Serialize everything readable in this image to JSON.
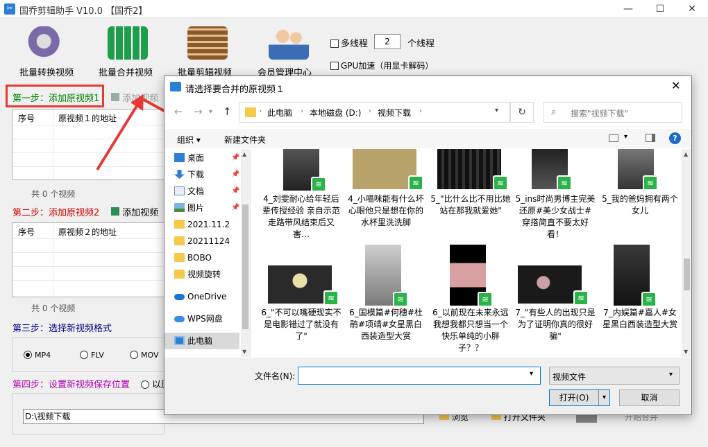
{
  "window": {
    "title": "国乔剪辑助手 V10.0   【国乔2】",
    "icon_text": "✂",
    "min": "—",
    "max": "☐",
    "close": "✕"
  },
  "toolbar": [
    {
      "label": "批量转换视频",
      "icon": "film-reel-convert-icon"
    },
    {
      "label": "批量合并视频",
      "icon": "merge-grid-icon"
    },
    {
      "label": "批量剪辑视频",
      "icon": "film-cut-icon"
    },
    {
      "label": "会员管理中心",
      "icon": "members-icon"
    }
  ],
  "options": {
    "multithread_label": "多线程",
    "thread_count": "2",
    "thread_unit": "个线程",
    "gpu_label": "GPU加速（用显卡解码）"
  },
  "step1": {
    "label": "第一步：添加原视频1",
    "add_label": "添加视频",
    "col_index": "序号",
    "col_addr": "原视频１的地址",
    "count": "共 0 个视频"
  },
  "step2": {
    "label": "第二步：添加原视频2",
    "add_label": "添加视频",
    "col_index": "序号",
    "col_addr": "原视频２的地址",
    "count": "共 0 个视频"
  },
  "step3": {
    "label": "第三步：选择新视频格式",
    "formats": [
      "MP4",
      "FLV",
      "MOV"
    ],
    "selected": "MP4"
  },
  "step4": {
    "label": "第四步：设置新视频保存位置",
    "option_partial": "以原",
    "path": "D:\\视频下载",
    "browse_label": "浏览",
    "open_folder_label": "打开文件夹",
    "start_label": "开始合并"
  },
  "dialog": {
    "title": "请选择要合并的原视频１",
    "close": "✕",
    "breadcrumb": [
      "此电脑",
      "本地磁盘 (D:)",
      "视频下载"
    ],
    "search_placeholder": "搜索\"视频下载\"",
    "organize_label": "组织 ▾",
    "new_folder_label": "新建文件夹",
    "nav": [
      {
        "label": "桌面",
        "icon": "desktop-icon",
        "pinned": true
      },
      {
        "label": "下载",
        "icon": "download-icon",
        "pinned": true
      },
      {
        "label": "文档",
        "icon": "document-icon",
        "pinned": true
      },
      {
        "label": "图片",
        "icon": "picture-icon",
        "pinned": true
      },
      {
        "label": "2021.11.2",
        "icon": "folder-icon"
      },
      {
        "label": "20211124",
        "icon": "folder-icon"
      },
      {
        "label": "BOBO",
        "icon": "folder-icon"
      },
      {
        "label": "视频旋转",
        "icon": "folder-icon"
      },
      {
        "label": "OneDrive",
        "icon": "cloud-icon"
      },
      {
        "label": "WPS网盘",
        "icon": "cloud-icon"
      },
      {
        "label": "此电脑",
        "icon": "computer-icon",
        "selected": true
      }
    ],
    "files": [
      {
        "name": "4_刘雯耐心给年轻后辈传授经验 亲自示范走路带风结束后又害…"
      },
      {
        "name": "4_小喵咪能有什么坏心眼他只是想在你的水杯里洗洗脚"
      },
      {
        "name": "5_\"比什么比不用比她站在那我就爱她\""
      },
      {
        "name": "5_ins时尚男博主完美还原#美少女战士#穿搭简直不要太好看！"
      },
      {
        "name": "5_我的爸妈拥有两个女儿"
      },
      {
        "name": "6_\"不可以嘴硬现实不是电影错过了就没有了\""
      },
      {
        "name": "6_国模篇#何穗#杜鹃#项靖#女星黑白西装造型大赏"
      },
      {
        "name": "6_以前现在未来永远我想我都只想当一个快乐单纯的小胖子？？"
      },
      {
        "name": "7_\"有些人的出现只是为了证明你真的很好骗\""
      },
      {
        "name": "7_内娱篇#嘉人#女星黑白西装造型大赏"
      }
    ],
    "filename_label": "文件名(N):",
    "filename_value": "",
    "filetype": "视频文件",
    "open_label": "打开(O)",
    "cancel_label": "取消"
  },
  "colors": {
    "step1": "#008000",
    "step2": "#cc0000",
    "step3": "#000080",
    "step4": "#b000b0",
    "annotation": "#e53935",
    "badge": "#2bb34a"
  }
}
